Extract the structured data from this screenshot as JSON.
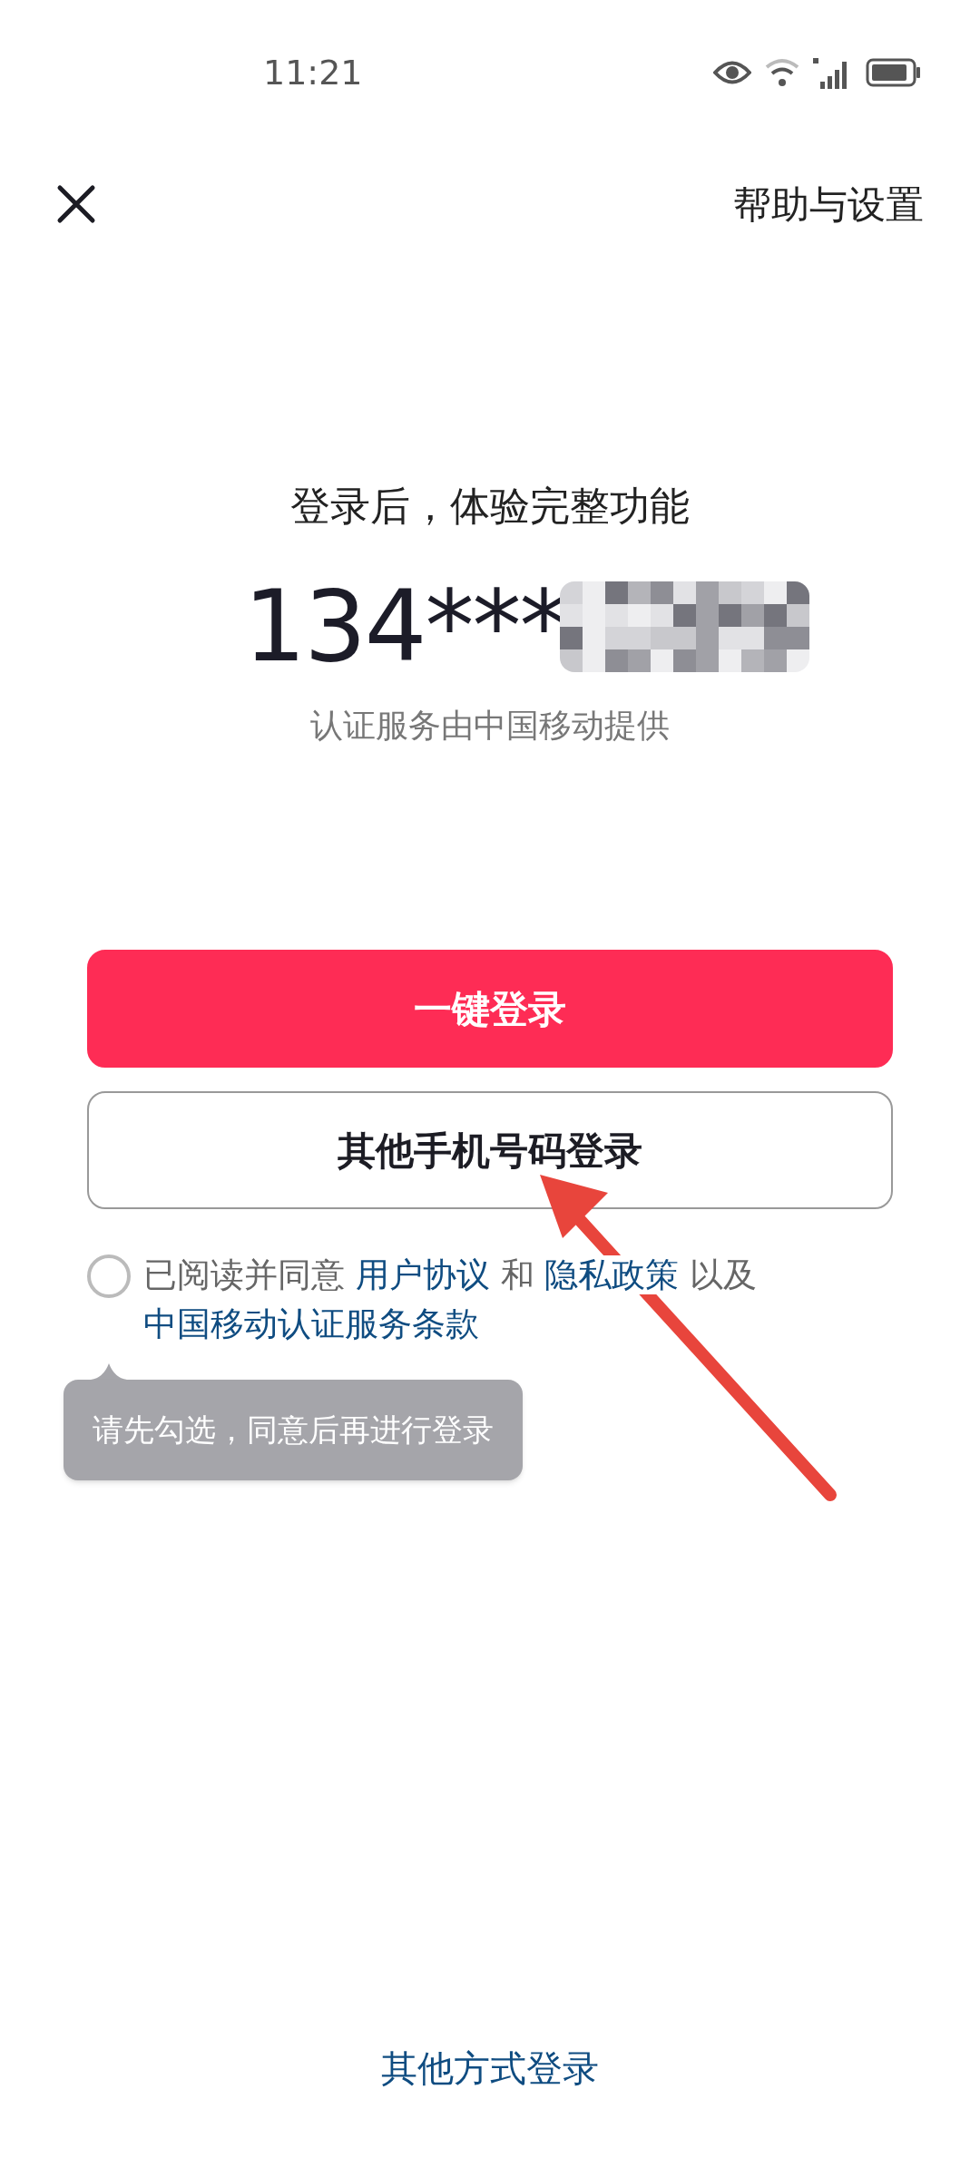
{
  "status_bar": {
    "time": "11:21"
  },
  "header": {
    "help_link": "帮助与设置"
  },
  "headline": "登录后，体验完整功能",
  "phone": {
    "visible": "134***",
    "masked": true
  },
  "provider_note": "认证服务由中国移动提供",
  "buttons": [
    {
      "kind": "primary",
      "label": "一键登录"
    },
    {
      "kind": "outline",
      "label": "其他手机号码登录"
    }
  ],
  "agreement": {
    "checked": false,
    "parts": [
      {
        "kind": "text",
        "text": "已阅读并同意"
      },
      {
        "kind": "link",
        "text": "用户协议"
      },
      {
        "kind": "text",
        "text": "和"
      },
      {
        "kind": "link",
        "text": "隐私政策"
      },
      {
        "kind": "text",
        "text": "以及"
      },
      {
        "kind": "link",
        "text": "中国移动认证服务条款"
      }
    ]
  },
  "tooltip": "请先勾选，同意后再进行登录",
  "bottom_link": "其他方式登录"
}
